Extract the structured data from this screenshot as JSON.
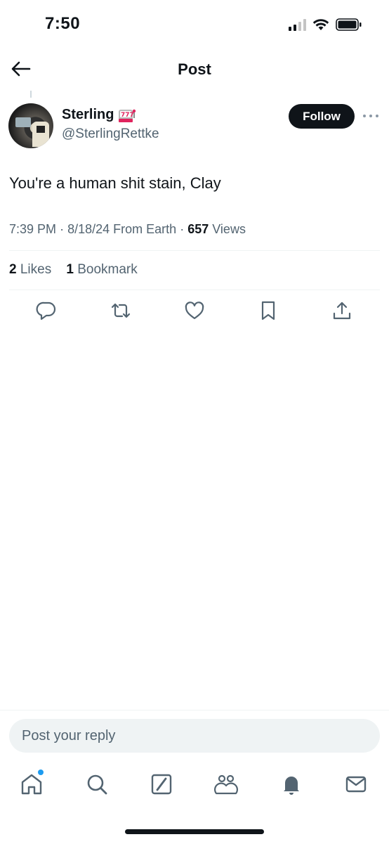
{
  "status_bar": {
    "time": "7:50"
  },
  "header": {
    "title": "Post"
  },
  "post": {
    "author": {
      "name": "Sterling",
      "handle": "@SterlingRettke",
      "name_emoji": "slot-machine-icon"
    },
    "follow_label": "Follow",
    "text": "You're a human shit stain, Clay",
    "meta": {
      "time": "7:39 PM",
      "date": "8/18/24",
      "source": "From Earth",
      "views_count": "657",
      "views_label": "Views"
    },
    "stats": {
      "likes_count": "2",
      "likes_label": "Likes",
      "bookmarks_count": "1",
      "bookmarks_label": "Bookmark"
    }
  },
  "reply": {
    "placeholder": "Post your reply"
  },
  "colors": {
    "accent": "#1d9bf0",
    "text": "#0f1419",
    "muted": "#536471",
    "divider": "#eff3f4"
  },
  "icons": {
    "actions": [
      "reply-icon",
      "repost-icon",
      "like-icon",
      "bookmark-icon",
      "share-icon"
    ],
    "tabs": [
      "home-icon",
      "search-icon",
      "grok-icon",
      "communities-icon",
      "notifications-icon",
      "messages-icon"
    ]
  }
}
